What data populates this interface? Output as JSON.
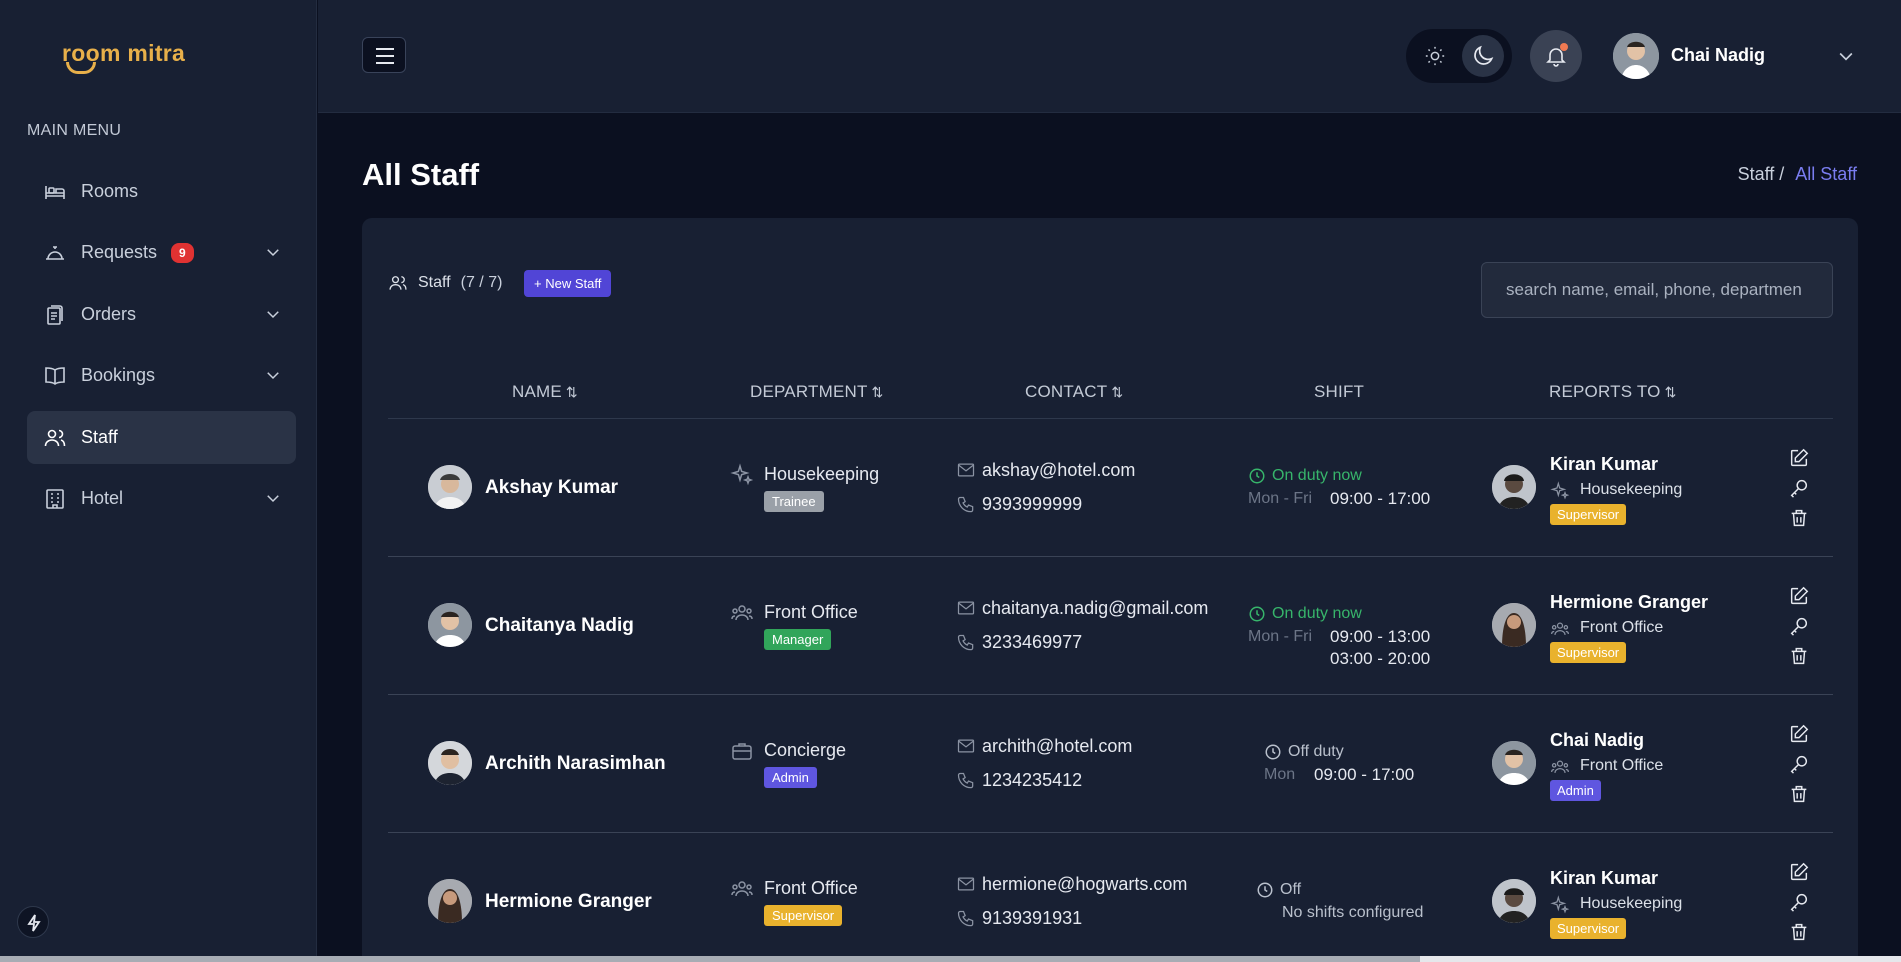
{
  "app": {
    "logo": "room mitra"
  },
  "sidebar": {
    "menu_title": "MAIN MENU",
    "items": [
      {
        "label": "Rooms",
        "icon": "bed-icon"
      },
      {
        "label": "Requests",
        "icon": "bell-service-icon",
        "badge": "9"
      },
      {
        "label": "Orders",
        "icon": "clipboard-icon"
      },
      {
        "label": "Bookings",
        "icon": "book-icon"
      },
      {
        "label": "Staff",
        "icon": "users-icon",
        "active": true
      },
      {
        "label": "Hotel",
        "icon": "building-icon"
      }
    ]
  },
  "topbar": {
    "user_name": "Chai Nadig"
  },
  "page": {
    "title": "All Staff",
    "breadcrumb_parent": "Staff /",
    "breadcrumb_current": "All Staff"
  },
  "staff_card": {
    "label": "Staff",
    "count": "(7 / 7)",
    "new_button": "+ New Staff",
    "search_placeholder": "search name, email, phone, departmen"
  },
  "columns": {
    "name": "NAME",
    "department": "DEPARTMENT",
    "contact": "CONTACT",
    "shift": "SHIFT",
    "reports_to": "REPORTS TO",
    "sort_glyph": "⇅"
  },
  "rows": [
    {
      "name": "Akshay Kumar",
      "department": "Housekeeping",
      "dept_icon": "sparkles-icon",
      "role": "Trainee",
      "email": "akshay@hotel.com",
      "phone": "9393999999",
      "shift_status": "On duty now",
      "shift_days": "Mon - Fri",
      "shift_times": [
        "09:00 - 17:00"
      ],
      "reports_name": "Kiran Kumar",
      "reports_dept": "Housekeeping",
      "reports_role": "Supervisor"
    },
    {
      "name": "Chaitanya Nadig",
      "department": "Front Office",
      "dept_icon": "users-icon",
      "role": "Manager",
      "email": "chaitanya.nadig@gmail.com",
      "phone": "3233469977",
      "shift_status": "On duty now",
      "shift_days": "Mon - Fri",
      "shift_times": [
        "09:00 - 13:00",
        "03:00 - 20:00"
      ],
      "reports_name": "Hermione Granger",
      "reports_dept": "Front Office",
      "reports_role": "Supervisor"
    },
    {
      "name": "Archith Narasimhan",
      "department": "Concierge",
      "dept_icon": "briefcase-icon",
      "role": "Admin",
      "email": "archith@hotel.com",
      "phone": "1234235412",
      "shift_status": "Off duty",
      "shift_days": "Mon",
      "shift_times": [
        "09:00 - 17:00"
      ],
      "reports_name": "Chai Nadig",
      "reports_dept": "Front Office",
      "reports_role": "Admin"
    },
    {
      "name": "Hermione Granger",
      "department": "Front Office",
      "dept_icon": "users-icon",
      "role": "Supervisor",
      "email": "hermione@hogwarts.com",
      "phone": "9139391931",
      "shift_status": "Off",
      "shift_note": "No shifts configured",
      "reports_name": "Kiran Kumar",
      "reports_dept": "Housekeeping",
      "reports_role": "Supervisor"
    }
  ],
  "colors": {
    "accent": "#5145d6",
    "on_duty": "#37b56b",
    "badge_red": "#e03232",
    "supervisor": "#e9b22d",
    "manager": "#31a55a",
    "trainee": "#9aa0a8",
    "admin": "#5f56e0"
  }
}
